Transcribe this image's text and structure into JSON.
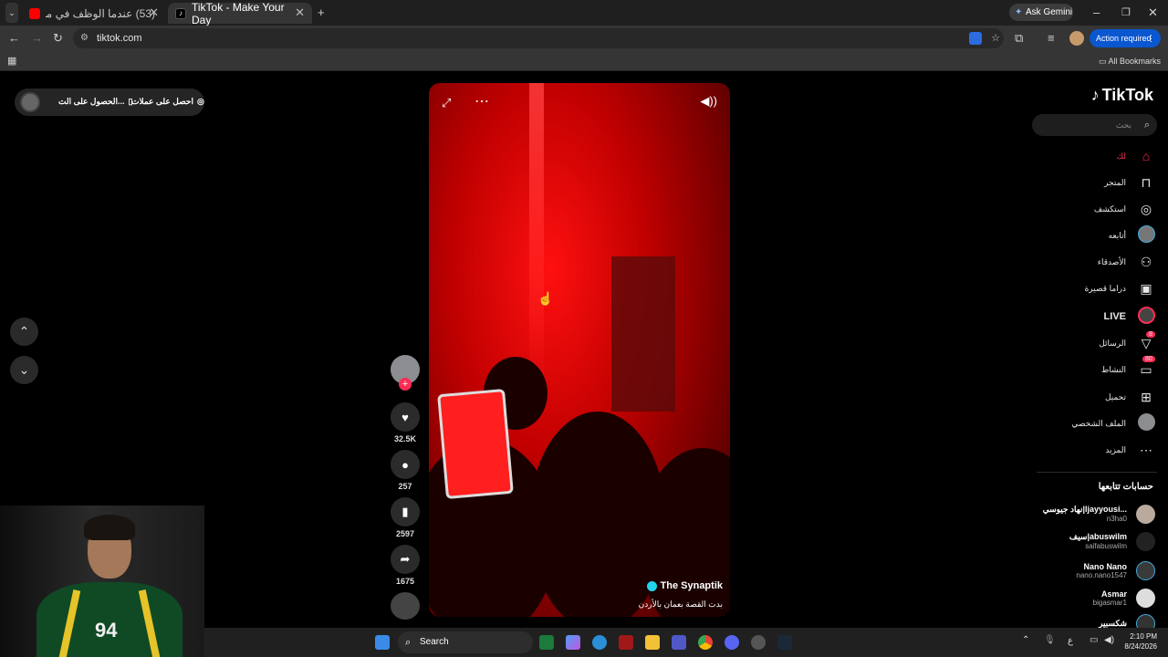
{
  "browser": {
    "tabs": [
      {
        "title": "(53) عندما الوظف في مطعم بيتزا",
        "icon": "youtube-icon",
        "active": false
      },
      {
        "title": "TikTok - Make Your Day",
        "icon": "tiktok-icon",
        "active": true
      }
    ],
    "url": "tiktok.com",
    "ask_gemini": "Ask Gemini",
    "action_required": "Action required",
    "all_bookmarks": "All Bookmarks"
  },
  "tiktok": {
    "logo": "TikTok",
    "search_placeholder": "بحث",
    "topbar": {
      "get_coins": "احصل على عملات",
      "get_app": "الحصول على الت..."
    },
    "nav": [
      {
        "label": "لك",
        "icon": "home-icon",
        "active": true
      },
      {
        "label": "المتجر",
        "icon": "shop-icon"
      },
      {
        "label": "استكشف",
        "icon": "compass-icon"
      },
      {
        "label": "أتابعه",
        "icon": "following-avatar"
      },
      {
        "label": "الأصدقاء",
        "icon": "friends-icon"
      },
      {
        "label": "دراما قصيرة",
        "icon": "film-icon"
      },
      {
        "label": "LIVE",
        "icon": "live-icon"
      },
      {
        "label": "الرسائل",
        "icon": "send-icon",
        "badge": "8"
      },
      {
        "label": "النشاط",
        "icon": "inbox-icon",
        "badge": "80"
      },
      {
        "label": "تحميل",
        "icon": "plus-square-icon"
      },
      {
        "label": "الملف الشخصي",
        "icon": "profile-avatar"
      },
      {
        "label": "المزيد",
        "icon": "more-icon"
      }
    ],
    "following_title": "حسابات تتابعها",
    "following": [
      {
        "name": "نهاد جيوسي|ljayyousi...",
        "handle": "n3ha0"
      },
      {
        "name": "سيف|abuswilm",
        "handle": "saifabuswilm"
      },
      {
        "name": "Nano Nano",
        "handle": "nano.nano1547"
      },
      {
        "name": "Asmar",
        "handle": "bigasmar1"
      },
      {
        "name": "شكسبير",
        "handle": ""
      }
    ],
    "video": {
      "author": "The Synaptik",
      "caption": "بدت القصة بعمان  بالأردن"
    },
    "actions": {
      "likes": "32.5K",
      "comments": "257",
      "saves": "2597",
      "shares": "1675"
    }
  },
  "taskbar": {
    "search": "Search",
    "time": "2:10 PM",
    "date": "8/24/2026",
    "lang": "ع"
  },
  "webcam": {
    "jersey_number": "94"
  }
}
